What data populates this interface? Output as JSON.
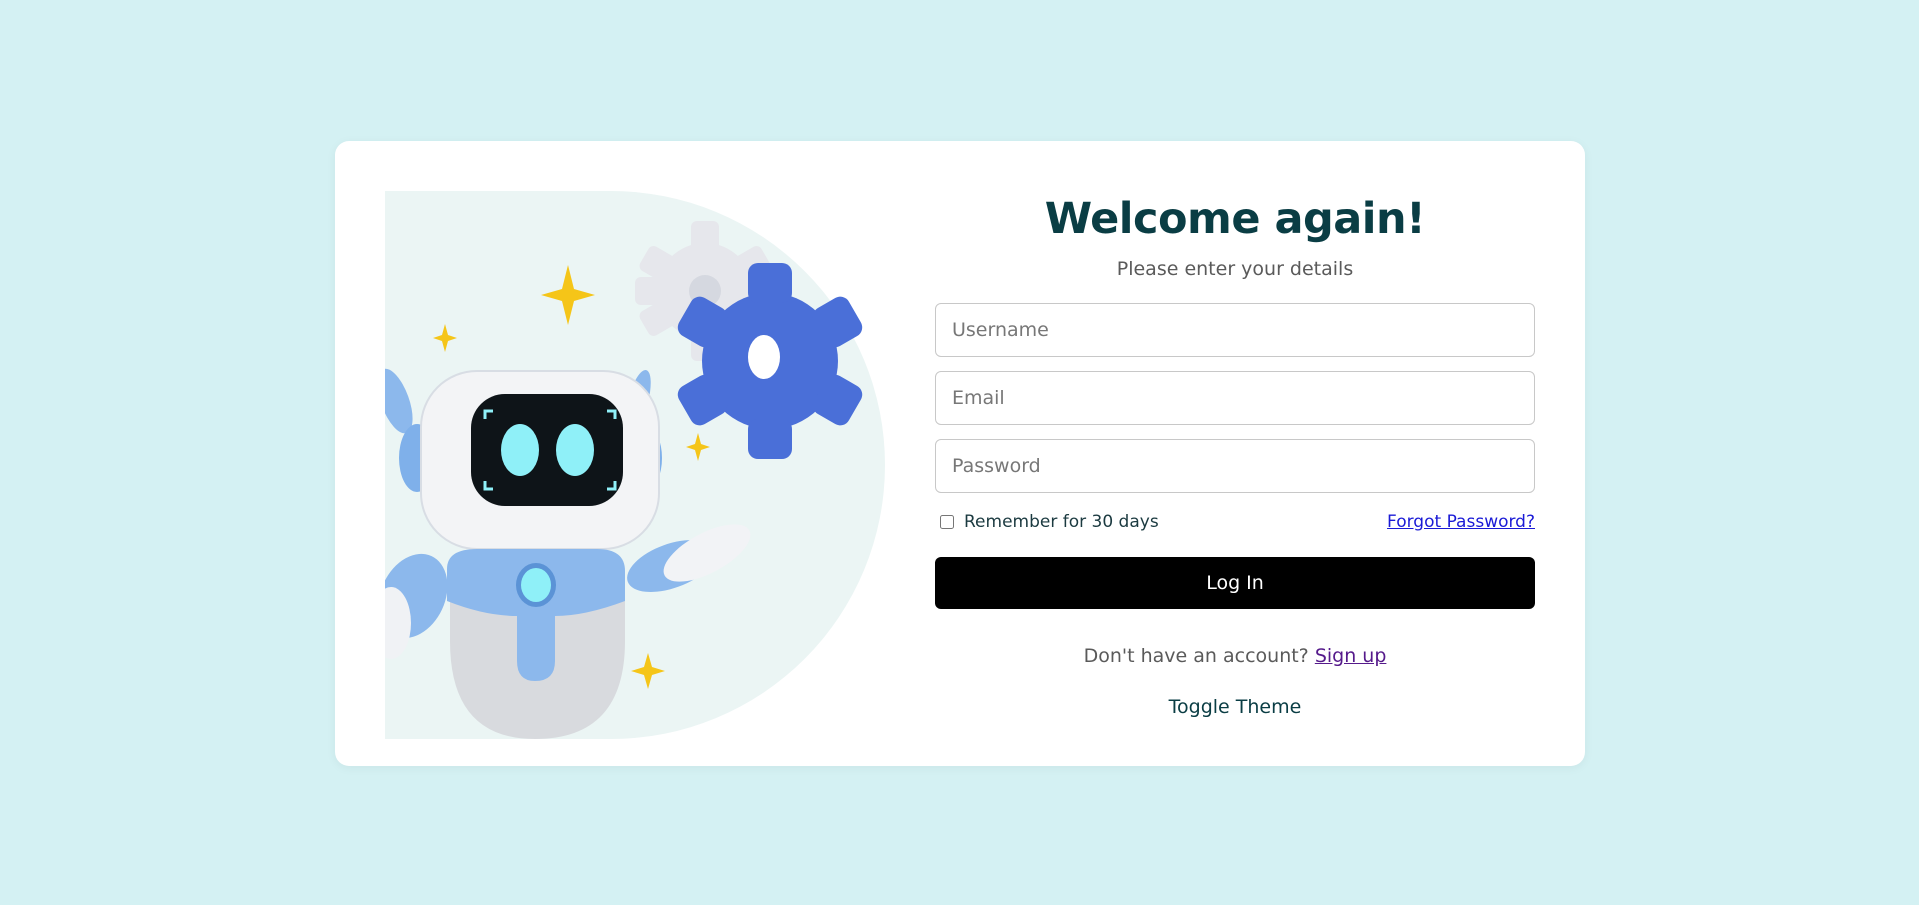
{
  "login": {
    "title": "Welcome again!",
    "subtitle": "Please enter your details",
    "username_placeholder": "Username",
    "email_placeholder": "Email",
    "password_placeholder": "Password",
    "remember_label": "Remember for 30 days",
    "forgot_label": "Forgot Password?",
    "login_label": "Log In",
    "signup_prompt": "Don't have an account?",
    "signup_label": "Sign up",
    "toggle_label": "Toggle Theme"
  },
  "illustration": {
    "icon": "robot-with-gears-illustration"
  },
  "colors": {
    "page_bg": "#d4f1f3",
    "card_bg": "#ffffff",
    "title": "#0a3d44",
    "button_bg": "#000000",
    "link": "#1a1ad6",
    "visited_link": "#551a8b"
  }
}
